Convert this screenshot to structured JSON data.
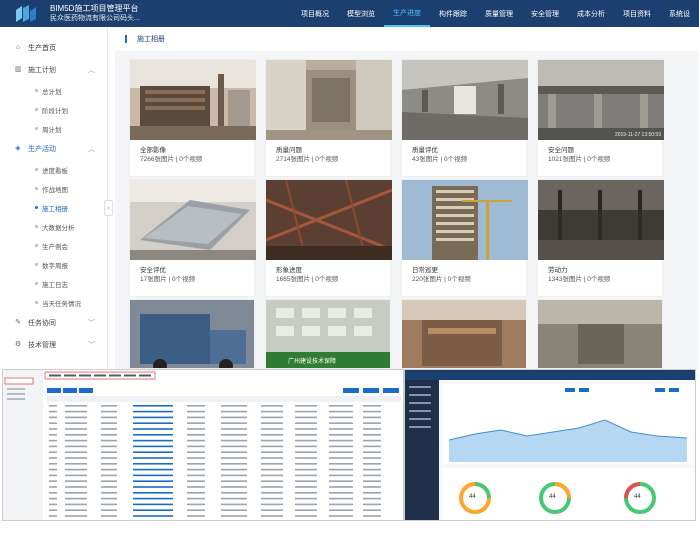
{
  "app": {
    "title_line1": "BIM5D施工项目管理平台",
    "title_line2": "民众医药物流有限公司码头..."
  },
  "topnav": [
    {
      "label": "项目概况",
      "active": false
    },
    {
      "label": "模型浏览",
      "active": false
    },
    {
      "label": "生产进度",
      "active": true
    },
    {
      "label": "构件跟踪",
      "active": false
    },
    {
      "label": "质量管理",
      "active": false
    },
    {
      "label": "安全管理",
      "active": false
    },
    {
      "label": "成本分析",
      "active": false
    },
    {
      "label": "项目资料",
      "active": false
    },
    {
      "label": "系统设",
      "active": false
    }
  ],
  "sidebar": {
    "home": "生产首页",
    "plan_group": "施工计划",
    "plan_items": [
      "总计划",
      "阶段计划",
      "周计划"
    ],
    "activity_group": "生产活动",
    "activity_items": [
      "进度看板",
      "作战地图",
      "施工相册",
      "大数据分析",
      "生产例会",
      "数字周报",
      "施工日志",
      "当天任务情况"
    ],
    "active_item": "施工相册",
    "task_group": "任务协同",
    "tech_group": "技术管理"
  },
  "main": {
    "header": "施工相册"
  },
  "cards": [
    {
      "name": "全部影像",
      "count": "7266张图片 | 0个视频",
      "stamp": ""
    },
    {
      "name": "质量问题",
      "count": "2714张图片 | 0个视频",
      "stamp": ""
    },
    {
      "name": "质量评优",
      "count": "43张图片 | 0个视频",
      "stamp": ""
    },
    {
      "name": "安全问题",
      "count": "1021张图片 | 0个视频",
      "stamp": "2019-11-27 13:50:59"
    },
    {
      "name": "安全评优",
      "count": "17张图片 | 0个视频",
      "stamp": ""
    },
    {
      "name": "形象进度",
      "count": "1665张图片 | 0个视频",
      "stamp": ""
    },
    {
      "name": "日常巡更",
      "count": "220张图片 | 0个视频",
      "stamp": ""
    },
    {
      "name": "劳动力",
      "count": "1343张图片 | 0个视频",
      "stamp": ""
    }
  ],
  "banner_text": "广州建设技术保障",
  "bottom_right_big_numbers": [
    "44",
    "44",
    "44"
  ],
  "colors": {
    "topbar": "#1b3f6e",
    "accent": "#4ec3ff",
    "link": "#1b6bc9"
  }
}
